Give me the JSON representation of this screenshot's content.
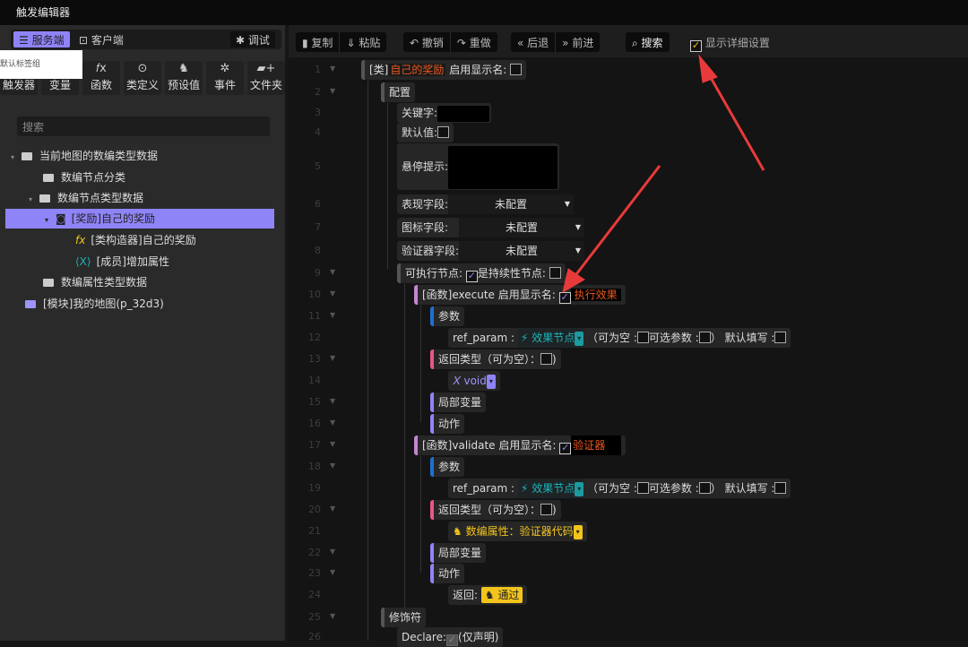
{
  "window": {
    "title": "触发编辑器"
  },
  "left": {
    "tabs": [
      {
        "label": "服务端",
        "icon": "server-icon"
      },
      {
        "label": "客户端",
        "icon": "download-icon"
      }
    ],
    "debug_label": "调试",
    "tooltip": "默认标签组",
    "tools": [
      {
        "label": "触发器",
        "icon": ""
      },
      {
        "label": "变量",
        "icon": ""
      },
      {
        "label": "函数",
        "icon": "𝑓x"
      },
      {
        "label": "类定义",
        "icon": "⊙"
      },
      {
        "label": "预设值",
        "icon": "♞"
      },
      {
        "label": "事件",
        "icon": "✲"
      },
      {
        "label": "文件夹",
        "icon": "▰+"
      }
    ],
    "search_placeholder": "搜索",
    "tree": [
      "当前地图的数编类型数据",
      "数编节点分类",
      "数编节点类型数据",
      "[奖励]自己的奖励",
      "[类构造器]自己的奖励",
      "[成员]增加属性",
      "数编属性类型数据",
      "[模块]我的地图(p_32d3)"
    ]
  },
  "toolbar": {
    "copy": "复制",
    "paste": "粘贴",
    "undo": "撤销",
    "redo": "重做",
    "back": "后退",
    "forward": "前进",
    "search": "搜索",
    "show_details": "显示详细设置",
    "show_details_checked": true
  },
  "editor": {
    "line_numbers": [
      "1",
      "2",
      "3",
      "4",
      "5",
      "6",
      "7",
      "8",
      "9",
      "10",
      "11",
      "12",
      "13",
      "14",
      "15",
      "16",
      "17",
      "18",
      "19",
      "20",
      "21",
      "22",
      "23",
      "24",
      "25",
      "26"
    ],
    "class_prefix": "[类]",
    "class_name": "自己的奖励",
    "enable_display_name": "启用显示名:",
    "config": "配置",
    "keyword": "关键字:",
    "default_value": "默认值:",
    "hover_tip": "悬停提示:",
    "display_field": "表现字段:",
    "icon_field": "图标字段:",
    "validator_field": "验证器字段:",
    "unconfigured": "未配置",
    "executable": "可执行节点:",
    "persistent": "是持续性节点:",
    "func1": "[函数]execute 启用显示名:",
    "func1_display": "执行效果",
    "params": "参数",
    "ref_param": "ref_param :",
    "effect_node": "效果节点",
    "nullable_open": "（可为空 :",
    "optional": "可选参数 :",
    "close_paren": "）",
    "default_fill": "默认填写 :",
    "return_type": "返回类型（可为空）：",
    "void": "void",
    "locals": "局部变量",
    "actions": "动作",
    "func2": "[函数]validate 启用显示名:",
    "func2_display": "验证器",
    "return_type2_value": "数编属性：验证器代码",
    "return_label": "返回:",
    "pass": "通过",
    "modifiers": "修饰符",
    "declare": "Declare:",
    "declare_only": "(仅声明)"
  },
  "colors": {
    "accent": "#8f84f7",
    "orange": "#e8571e",
    "teal": "#1cb3b8",
    "yellow": "#f3c41c",
    "arrow": "#e83a3a"
  }
}
